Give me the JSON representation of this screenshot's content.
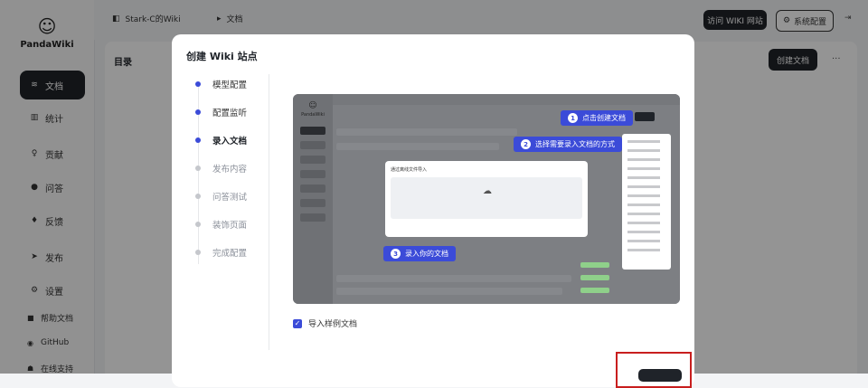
{
  "app": {
    "name": "PandaWiki"
  },
  "sidebar": {
    "items": [
      {
        "label": "文档",
        "icon": "stack-icon",
        "active": true
      },
      {
        "label": "统计",
        "icon": "bar-chart-icon"
      },
      {
        "label": "贡献",
        "icon": "user-plus-icon"
      },
      {
        "label": "问答",
        "icon": "chat-icon"
      },
      {
        "label": "反馈",
        "icon": "thumbs-up-icon"
      },
      {
        "label": "发布",
        "icon": "send-icon"
      },
      {
        "label": "设置",
        "icon": "gear-icon"
      }
    ],
    "footer": [
      {
        "label": "帮助文档",
        "icon": "book-icon"
      },
      {
        "label": "GitHub",
        "icon": "github-icon"
      },
      {
        "label": "在线支持",
        "icon": "support-icon"
      }
    ]
  },
  "topbar": {
    "breadcrumb": [
      "Stark-C的Wiki",
      "文档"
    ],
    "visit_button": "访问 WIKI 网站",
    "settings_button": "系统配置"
  },
  "content": {
    "title": "目录",
    "create_button": "创建文档",
    "more_label": "···"
  },
  "modal": {
    "title": "创建 Wiki 站点",
    "steps": [
      {
        "label": "模型配置",
        "state": "done"
      },
      {
        "label": "配置监听",
        "state": "done"
      },
      {
        "label": "录入文档",
        "state": "current"
      },
      {
        "label": "发布内容",
        "state": "pending"
      },
      {
        "label": "问答测试",
        "state": "pending"
      },
      {
        "label": "装饰页面",
        "state": "pending"
      },
      {
        "label": "完成配置",
        "state": "pending"
      }
    ],
    "preview": {
      "callouts": [
        {
          "num": "1",
          "text": "点击创建文档"
        },
        {
          "num": "2",
          "text": "选择需要录入文档的方式"
        },
        {
          "num": "3",
          "text": "录入你的文档"
        }
      ],
      "dialog_title": "通过离线文件导入"
    },
    "checkbox": {
      "label": "导入样例文档",
      "checked": true
    }
  },
  "colors": {
    "accent": "#3b4bd8",
    "dark": "#1f2329",
    "highlight": "#c81e1e"
  }
}
